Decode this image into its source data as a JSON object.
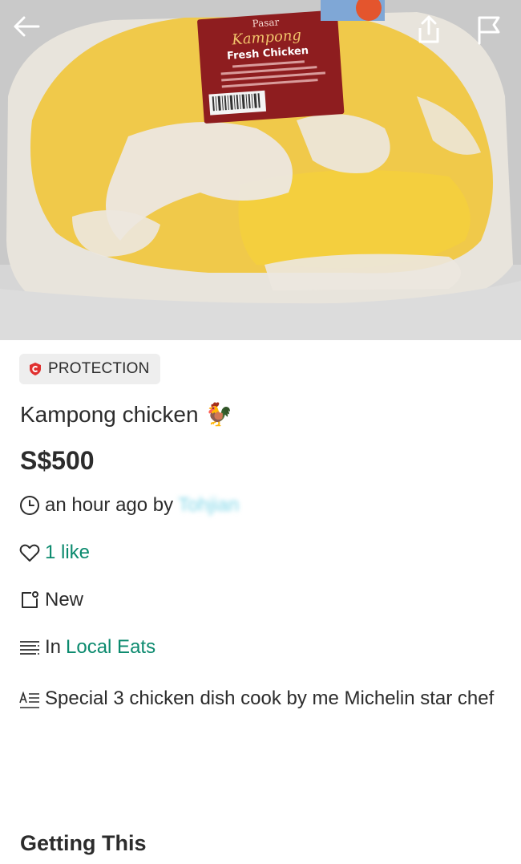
{
  "hero": {
    "label_brand": "Pasar",
    "label_name": "Kampong",
    "label_product": "Fresh Chicken"
  },
  "badge": {
    "label": "PROTECTION"
  },
  "listing": {
    "title": "Kampong chicken",
    "title_emoji": "🐓",
    "price": "S$500",
    "posted": "an hour ago by",
    "seller": "Tohjian",
    "likes": "1 like",
    "condition": "New",
    "category_prefix": "In",
    "category": "Local Eats",
    "description": "Special 3 chicken dish cook by me Michelin star chef"
  },
  "sections": {
    "getting": "Getting This"
  },
  "colors": {
    "accent": "#0b8a6e",
    "badge_bg": "#eeeeee",
    "shield": "#e0302f"
  },
  "icons": [
    "back-arrow-icon",
    "share-icon",
    "flag-icon",
    "shield-icon",
    "clock-icon",
    "heart-icon",
    "tag-icon",
    "list-icon",
    "text-icon"
  ]
}
